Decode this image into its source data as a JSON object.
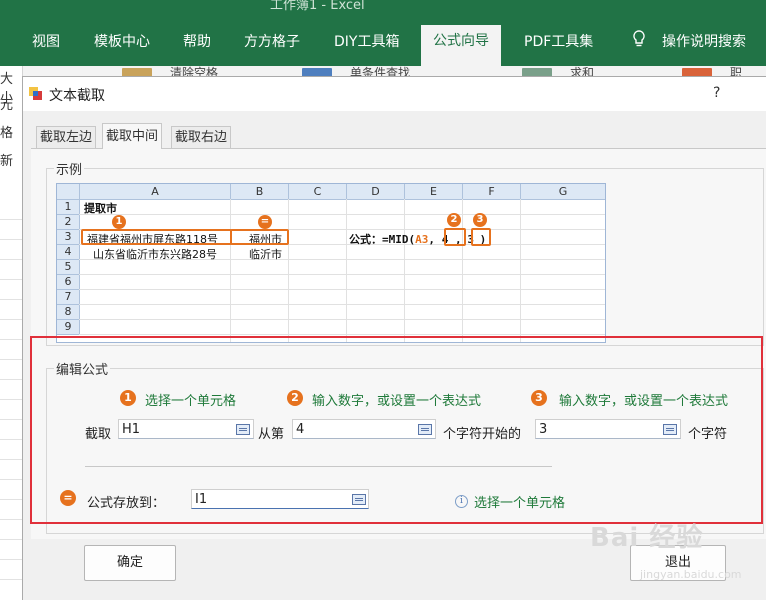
{
  "excel": {
    "window_title": "工作簿1 - Excel",
    "ribbon_tabs": [
      "视图",
      "模板中心",
      "帮助",
      "方方格子",
      "DIY工具箱",
      "公式向导",
      "PDF工具集",
      "操作说明搜索"
    ],
    "ribbon_strip": [
      "清除空格",
      "单条件查找",
      "求和",
      "职"
    ],
    "left_strip": [
      "大小",
      "元",
      "格",
      "新"
    ]
  },
  "dialog": {
    "title": "文本截取",
    "help": "?",
    "tabs": [
      "截取左边",
      "截取中间",
      "截取右边"
    ],
    "selected_tab": 1,
    "example": {
      "group_label": "示例",
      "columns": [
        "A",
        "B",
        "C",
        "D",
        "E",
        "F",
        "G"
      ],
      "rows": [
        "1",
        "2",
        "3",
        "4",
        "5",
        "6",
        "7",
        "8",
        "9"
      ],
      "a1": "提取市",
      "a3": "福建省福州市屏东路118号",
      "b3": "福州市",
      "a4": "山东省临沂市东兴路28号",
      "b4": "临沂市",
      "formula_prefix": "公式：=MID(",
      "formula_ref": "A3",
      "formula_comma1": ",",
      "formula_arg2": "4",
      "formula_comma2": ",",
      "formula_arg3": "3",
      "formula_close": ")",
      "badges": [
        "1",
        "2",
        "3",
        "="
      ]
    },
    "edit": {
      "group_label": "编辑公式",
      "steps": [
        {
          "icon": "1",
          "text": "选择一个单元格"
        },
        {
          "icon": "2",
          "text": "输入数字，或设置一个表达式"
        },
        {
          "icon": "3",
          "text": "输入数字，或设置一个表达式"
        }
      ],
      "label_extract": "截取",
      "cell_value": "H1",
      "label_from": "从第",
      "start_value": "4",
      "label_chars_start": "个字符开始的",
      "length_value": "3",
      "label_chars": "个字符",
      "store_icon": "=",
      "store_label": "公式存放到：",
      "store_value": "I1",
      "info_icon": "i",
      "info_text": "选择一个单元格"
    },
    "ok_label": "确定",
    "exit_label": "退出"
  },
  "watermark": {
    "text": "Bai 经验",
    "sub": "jingyan.baidu.com"
  },
  "colors": {
    "excel_green": "#217346",
    "accent_orange": "#e6721e",
    "step_green": "#1f7a3a",
    "highlight_red": "#e0303a"
  }
}
